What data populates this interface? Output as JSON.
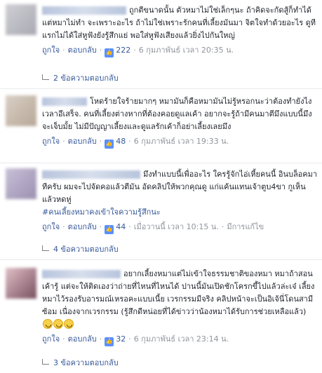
{
  "comments": [
    {
      "text": "ถูกตีขนาดนั้น ตัวหมาไม่ใช่เล็กๆนะ ถ้าคิดจะกัดสู้ก็ทำได้ แต่หมาไม่ทำ จะเพราะอะไร ถ้าไม่ใช่เพราะรักคนที่เลี้ยงมันมา จิตใจทำด้วยอะไร ดูทีแรกไม่ได้ใส่หูฟังยังรู้สึกแย่ พอใส่หูฟังเสียงแล้วยิ่งไปกันใหญ่",
      "like_label": "ถูกใจ",
      "reply_label": "ตอบกลับ",
      "like_count": "222",
      "timestamp": "6 กุมภาพันธ์ เวลา 20:35 น.",
      "replies_label": "2 ข้อความตอบกลับ"
    },
    {
      "text": "โหดร้ายใจร้ายมากๆ หมามันก็คือหมามันไม่รู้หรอกนะว่าต้องทำยังไงเวลาอึเสร็จ. คนที่เลี้ยงต่างหากที่ต้องคอยดูแลเค้า อยากจะรู้ถ้ามีคนมาตีมึงแบบนี้มึงจะเจ็บมั้ย ไม่มีปัญญาเลี้ยงและดูแลรักเค้าก็อย่าเลี้ยงเลยมึง",
      "like_label": "ถูกใจ",
      "reply_label": "ตอบกลับ",
      "like_count": "48",
      "timestamp": "6 กุมภาพันธ์ เวลา 19:33 น."
    },
    {
      "text": "มึงทำแบบนี้เพื่ออะไร ใครรู้จักไอ่เหี้ยคนนี้ อินบล็อคมาทีครับ ผมจะไปจัดคอแล้วตีมัน อัดคลิปให้พวกคุณดู แก่แค้นแทนเจ้าตูบ4ขา กูเห็นแล้วหดหู่",
      "hashtag": "#คนเลี้ยงหมาคงเข้าใจความรู้สึกนะ",
      "like_label": "ถูกใจ",
      "reply_label": "ตอบกลับ",
      "like_count": "44",
      "timestamp": "เมื่อวานนี้ เวลา 10:15 น.",
      "edited_label": "มีการแก้ไข",
      "replies_label": "4 ข้อความตอบกลับ"
    },
    {
      "text": "อยากเลี้ยงหมาแต่ไม่เข้าใจธรรมชาติของหมา หมาถ้าสอนเค้ารู้ แต่จะให้ติดเองว่าถ่ายที่ไหนที่ไหนได้ ปานนี้มันเปิดชักโครกขี้ไปแล้วล่ะเจ๋ เลี้ยงหมาไว้รองรับอารมณ์เหรอคะแบบเนี้ย เวรกรรมมีจริง คลิปหน้าจะเป็นอิเจ้นี่โดนสามีซ้อม เนื่องจากเวรกรรม (รู้สึกดีหน่อยที่ได้ข่าวว่าน้องหมาได้รับการช่วยเหลือแล้ว)",
      "like_label": "ถูกใจ",
      "reply_label": "ตอบกลับ",
      "like_count": "32",
      "timestamp": "6 กุมภาพันธ์ เวลา 23:14 น.",
      "replies_label": "3 ข้อความตอบกลับ"
    }
  ],
  "icons": {
    "like_badge": "thumbs-up-icon",
    "reply_arrow": "reply-arrow-icon",
    "emoji": "grimacing-face-icon"
  },
  "colors": {
    "link": "#365899",
    "meta": "#90949c",
    "like_badge": "#5890ff"
  }
}
